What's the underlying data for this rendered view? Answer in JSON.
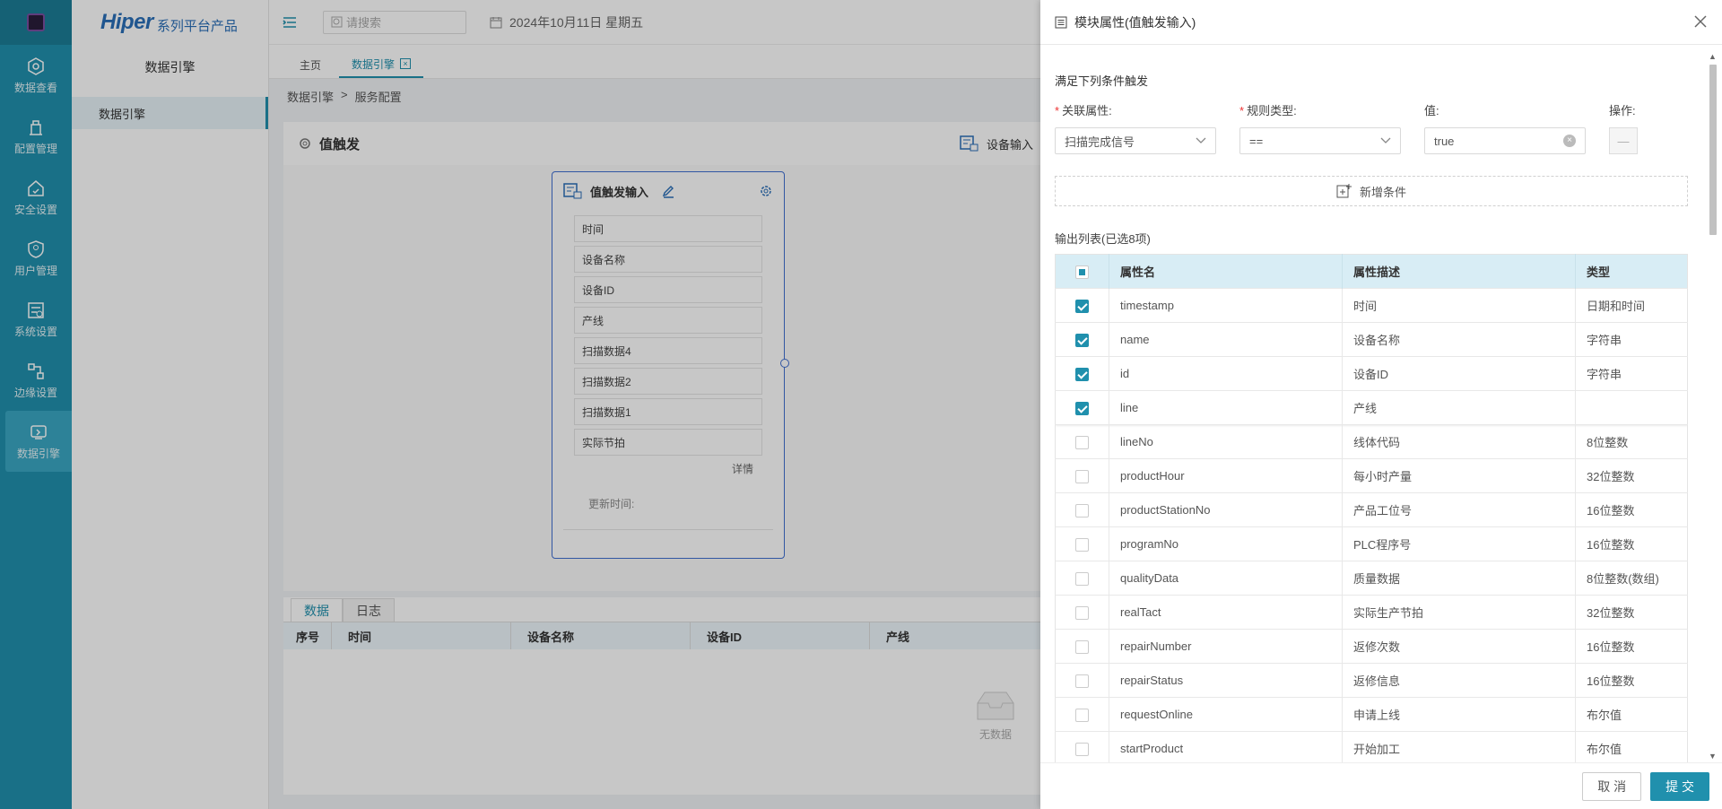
{
  "rail": {
    "items": [
      {
        "label": "数据查看",
        "icon": "data-view-icon"
      },
      {
        "label": "配置管理",
        "icon": "config-icon"
      },
      {
        "label": "安全设置",
        "icon": "security-icon"
      },
      {
        "label": "用户管理",
        "icon": "user-icon"
      },
      {
        "label": "系统设置",
        "icon": "system-icon"
      },
      {
        "label": "边缘设置",
        "icon": "edge-icon"
      },
      {
        "label": "数据引擎",
        "icon": "engine-icon",
        "active": true
      }
    ]
  },
  "brand": {
    "name": "Hiper",
    "sub": "系列平台产品"
  },
  "subnav": {
    "title": "数据引擎",
    "item": "数据引擎"
  },
  "topbar": {
    "search_placeholder": "请搜索",
    "date": "2024年10月11日 星期五"
  },
  "tabs": [
    {
      "label": "主页"
    },
    {
      "label": "数据引擎",
      "active": true,
      "close": "×"
    }
  ],
  "breadcrumb": {
    "root": "数据引擎",
    "sep": ">",
    "current": "服务配置"
  },
  "module": {
    "title": "值触发",
    "right_label": "设备输入"
  },
  "node": {
    "title": "值触发输入",
    "fields": [
      "时间",
      "设备名称",
      "设备ID",
      "产线",
      "扫描数据4",
      "扫描数据2",
      "扫描数据1",
      "实际节拍"
    ],
    "detail": "详情",
    "update_time_label": "更新时间:"
  },
  "bottom": {
    "tabs": [
      "数据",
      "日志"
    ],
    "columns": [
      "序号",
      "时间",
      "设备名称",
      "设备ID",
      "产线"
    ],
    "empty": "无数据"
  },
  "drawer": {
    "title": "模块属性(值触发输入)",
    "section_title": "满足下列条件触发",
    "labels": {
      "attr": "关联属性:",
      "rule": "规则类型:",
      "value": "值:",
      "op": "操作:"
    },
    "condition": {
      "attr": "扫描完成信号",
      "rule": "==",
      "value": "true",
      "op_symbol": "—"
    },
    "add_condition": "新增条件",
    "output_title": "输出列表(已选8项)",
    "table_headers": [
      "属性名",
      "属性描述",
      "类型"
    ],
    "rows": [
      {
        "name": "timestamp",
        "desc": "时间",
        "type": "日期和时间",
        "checked": true
      },
      {
        "name": "name",
        "desc": "设备名称",
        "type": "字符串",
        "checked": true
      },
      {
        "name": "id",
        "desc": "设备ID",
        "type": "字符串",
        "checked": true
      },
      {
        "name": "line",
        "desc": "产线",
        "type": "",
        "checked": true
      },
      {
        "name": "lineNo",
        "desc": "线体代码",
        "type": "8位整数",
        "checked": false
      },
      {
        "name": "productHour",
        "desc": "每小时产量",
        "type": "32位整数",
        "checked": false
      },
      {
        "name": "productStationNo",
        "desc": "产品工位号",
        "type": "16位整数",
        "checked": false
      },
      {
        "name": "programNo",
        "desc": "PLC程序号",
        "type": "16位整数",
        "checked": false
      },
      {
        "name": "qualityData",
        "desc": "质量数据",
        "type": "8位整数(数组)",
        "checked": false
      },
      {
        "name": "realTact",
        "desc": "实际生产节拍",
        "type": "32位整数",
        "checked": false
      },
      {
        "name": "repairNumber",
        "desc": "返修次数",
        "type": "16位整数",
        "checked": false
      },
      {
        "name": "repairStatus",
        "desc": "返修信息",
        "type": "16位整数",
        "checked": false
      },
      {
        "name": "requestOnline",
        "desc": "申请上线",
        "type": "布尔值",
        "checked": false
      },
      {
        "name": "startProduct",
        "desc": "开始加工",
        "type": "布尔值",
        "checked": false
      }
    ],
    "cancel": "取 消",
    "submit": "提 交"
  },
  "colors": {
    "primary": "#2090ad",
    "node_border": "#3f6fd1",
    "required": "#e33333"
  }
}
